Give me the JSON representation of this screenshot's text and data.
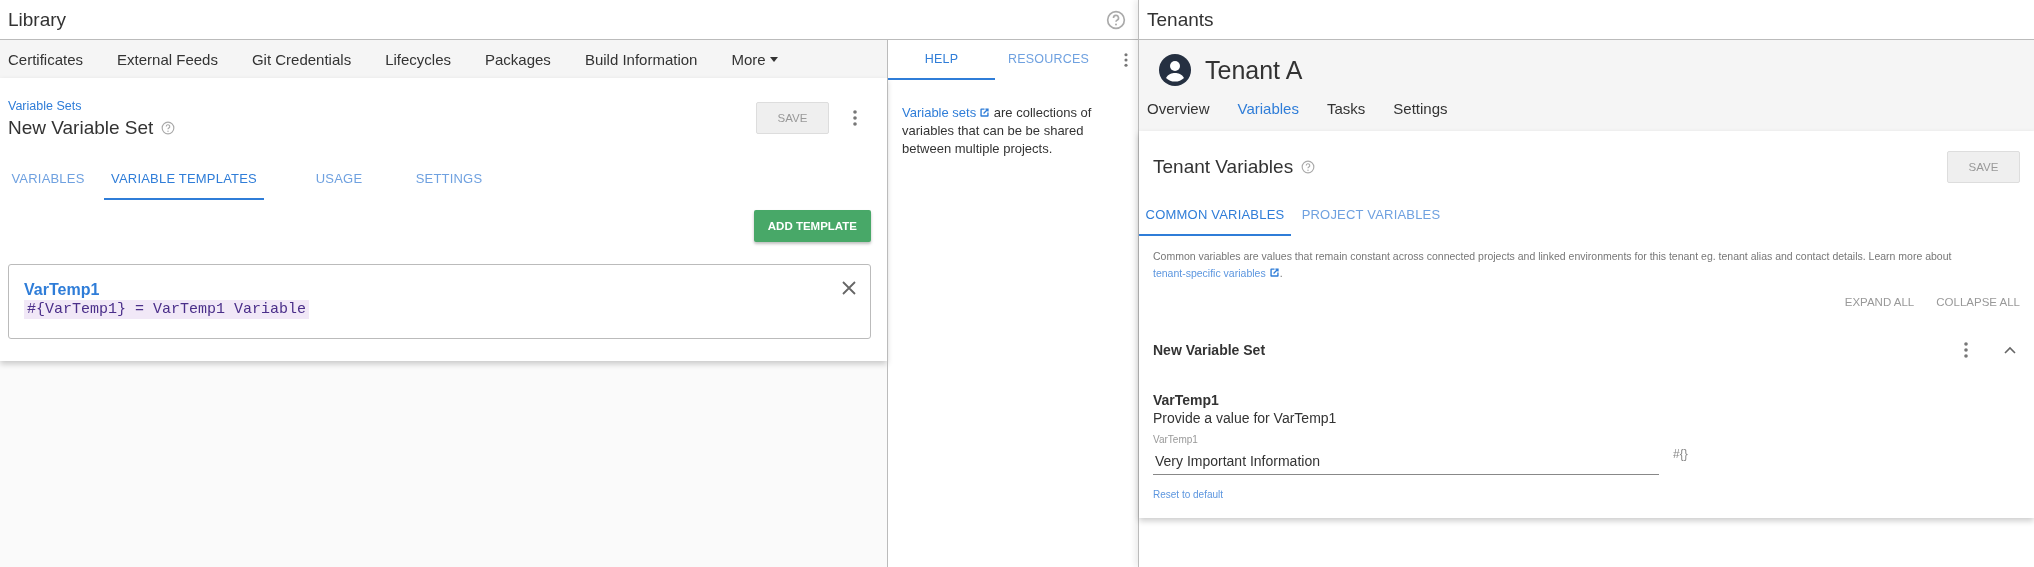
{
  "library": {
    "title": "Library",
    "nav": [
      {
        "label": "Certificates"
      },
      {
        "label": "External Feeds"
      },
      {
        "label": "Git Credentials"
      },
      {
        "label": "Lifecycles"
      },
      {
        "label": "Packages"
      },
      {
        "label": "Build Information"
      }
    ],
    "more": "More",
    "breadcrumb": "Variable Sets",
    "heading": "New Variable Set",
    "save": {
      "label": "SAVE",
      "disabled": true
    },
    "tabs": [
      {
        "label": "VARIABLES",
        "selected": false
      },
      {
        "label": "VARIABLE TEMPLATES",
        "selected": true
      },
      {
        "label": "USAGE",
        "selected": false
      },
      {
        "label": "SETTINGS",
        "selected": false
      }
    ],
    "add_button": "ADD TEMPLATE",
    "templates": [
      {
        "name": "VarTemp1",
        "expression": "#{VarTemp1} = VarTemp1 Variable"
      }
    ]
  },
  "help_pane": {
    "tabs": [
      {
        "label": "HELP",
        "selected": true
      },
      {
        "label": "RESOURCES",
        "selected": false
      }
    ],
    "link": "Variable sets",
    "text": "are collections of variables that can be be shared between multiple projects."
  },
  "tenants": {
    "title": "Tenants",
    "tenant_name": "Tenant A",
    "nav": [
      {
        "label": "Overview",
        "selected": false
      },
      {
        "label": "Variables",
        "selected": true
      },
      {
        "label": "Tasks",
        "selected": false
      },
      {
        "label": "Settings",
        "selected": false
      }
    ],
    "heading": "Tenant Variables",
    "save": {
      "label": "SAVE",
      "disabled": true
    },
    "tabs": [
      {
        "label": "COMMON VARIABLES",
        "selected": true
      },
      {
        "label": "PROJECT VARIABLES",
        "selected": false
      }
    ],
    "description": "Common variables are values that remain constant across connected projects and linked environments for this tenant eg. tenant alias and contact details. Learn more about",
    "link": "tenant-specific variables",
    "link_suffix": ".",
    "expand_all": "EXPAND ALL",
    "collapse_all": "COLLAPSE ALL",
    "section": {
      "title": "New Variable Set",
      "expanded": true,
      "variables": [
        {
          "name": "VarTemp1",
          "hint": "Provide a value for VarTemp1",
          "field_label": "VarTemp1",
          "value": "Very Important Information",
          "binding": "#{}",
          "reset": "Reset to default"
        }
      ]
    }
  }
}
